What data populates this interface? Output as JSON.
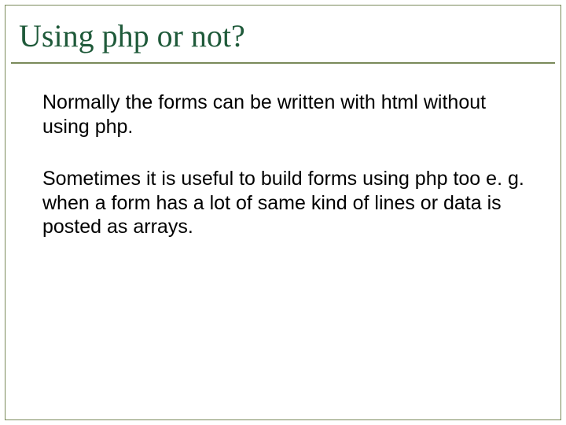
{
  "title": "Using php or not?",
  "paragraphs": [
    "Normally the forms can be written with html without using php.",
    "Sometimes it is useful to build forms using php too e. g. when a form has a lot of same kind of lines or data is posted as arrays."
  ]
}
